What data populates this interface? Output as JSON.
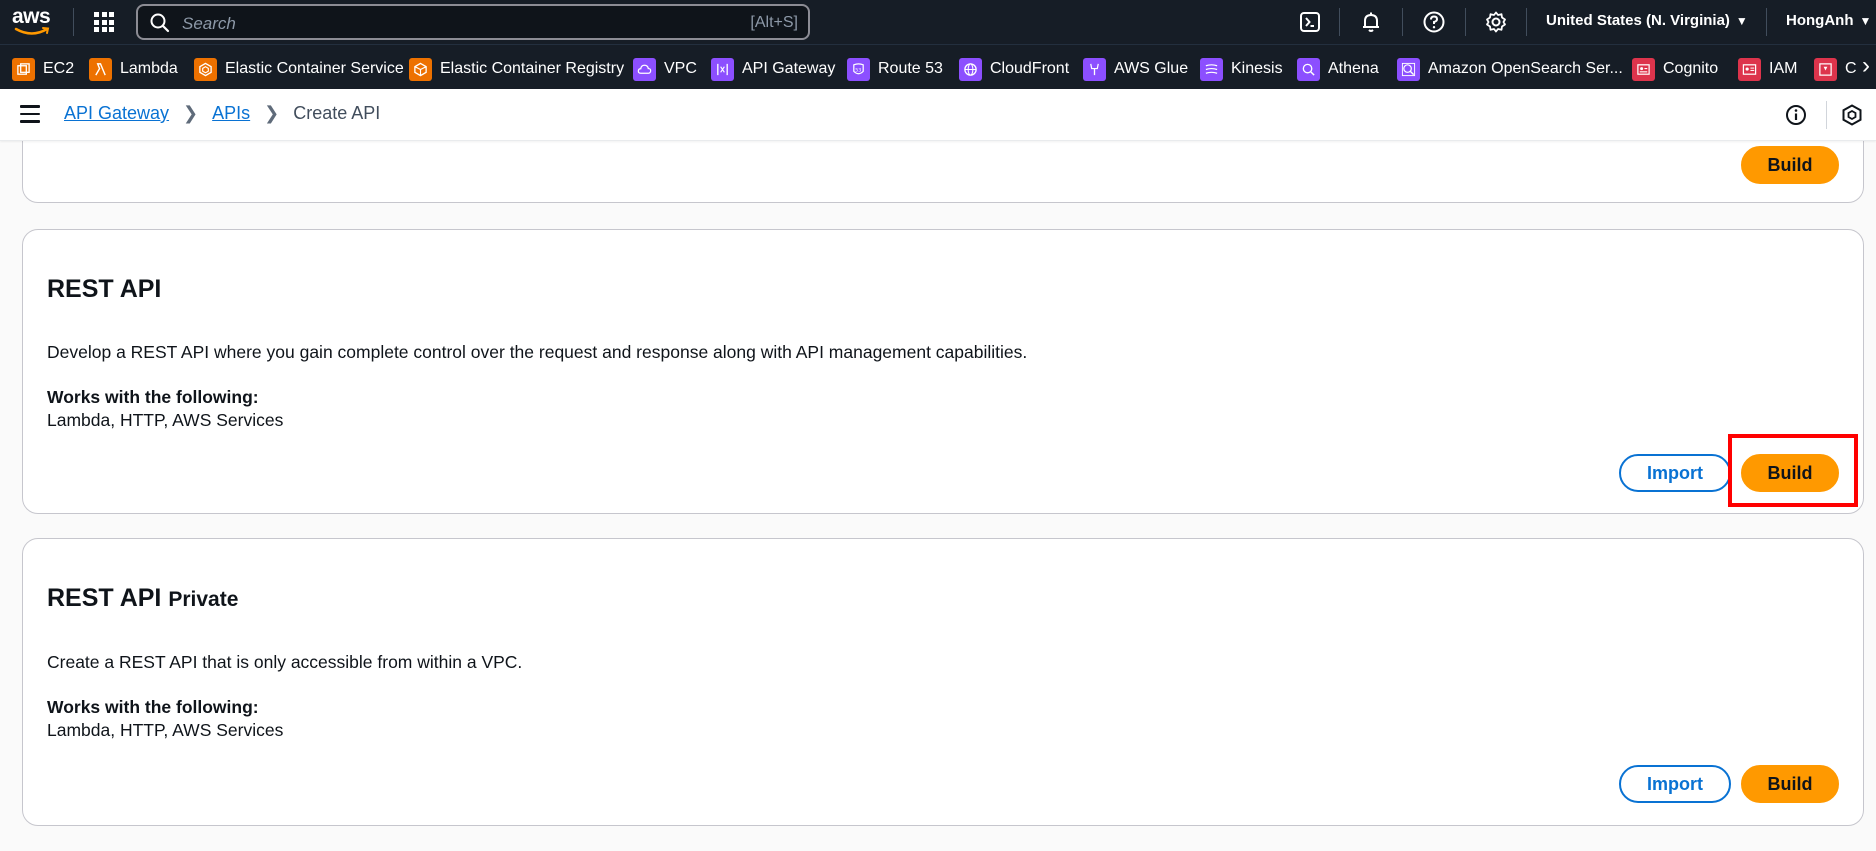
{
  "topbar": {
    "logo_text": "aws",
    "search_placeholder": "Search",
    "search_shortcut": "[Alt+S]",
    "region": "United States (N. Virginia)",
    "user": "HongAnh",
    "icons": [
      "cloudshell-icon",
      "bell-icon",
      "help-icon",
      "settings-icon"
    ]
  },
  "favorites": [
    {
      "label": "EC2",
      "color": "#ed7100",
      "icon": "ec2-icon"
    },
    {
      "label": "Lambda",
      "color": "#ed7100",
      "icon": "lambda-icon"
    },
    {
      "label": "Elastic Container Service",
      "color": "#ed7100",
      "icon": "ecs-icon"
    },
    {
      "label": "Elastic Container Registry",
      "color": "#ed7100",
      "icon": "ecr-icon"
    },
    {
      "label": "VPC",
      "color": "#8c4fff",
      "icon": "vpc-icon"
    },
    {
      "label": "API Gateway",
      "color": "#8c4fff",
      "icon": "api-gateway-icon"
    },
    {
      "label": "Route 53",
      "color": "#8c4fff",
      "icon": "route53-icon"
    },
    {
      "label": "CloudFront",
      "color": "#8c4fff",
      "icon": "cloudfront-icon"
    },
    {
      "label": "AWS Glue",
      "color": "#8c4fff",
      "icon": "glue-icon"
    },
    {
      "label": "Kinesis",
      "color": "#8c4fff",
      "icon": "kinesis-icon"
    },
    {
      "label": "Athena",
      "color": "#8c4fff",
      "icon": "athena-icon"
    },
    {
      "label": "Amazon OpenSearch Ser...",
      "color": "#8c4fff",
      "icon": "opensearch-icon"
    },
    {
      "label": "Cognito",
      "color": "#dd344c",
      "icon": "cognito-icon"
    },
    {
      "label": "IAM",
      "color": "#dd344c",
      "icon": "iam-icon"
    },
    {
      "label": "Ce",
      "color": "#dd344c",
      "icon": "certificate-icon"
    }
  ],
  "breadcrumb": {
    "items": [
      "API Gateway",
      "APIs"
    ],
    "current": "Create API"
  },
  "cards": {
    "top_partial": {
      "build_label": "Build"
    },
    "rest_api": {
      "title": "REST API",
      "description": "Develop a REST API where you gain complete control over the request and response along with API management capabilities.",
      "works_with_label": "Works with the following:",
      "works_with": "Lambda, HTTP, AWS Services",
      "import_label": "Import",
      "build_label": "Build"
    },
    "rest_api_private": {
      "title": "REST API",
      "title_suffix": "Private",
      "description": "Create a REST API that is only accessible from within a VPC.",
      "works_with_label": "Works with the following:",
      "works_with": "Lambda, HTTP, AWS Services",
      "import_label": "Import",
      "build_label": "Build"
    }
  },
  "colors": {
    "accent": "#ff9900",
    "link": "#0972d3",
    "header_bg": "#161d26",
    "highlight": "#ff0000"
  }
}
